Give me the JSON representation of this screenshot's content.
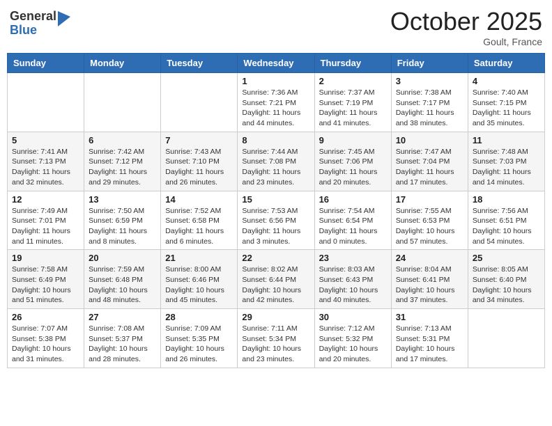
{
  "header": {
    "logo_general": "General",
    "logo_blue": "Blue",
    "month_title": "October 2025",
    "location": "Goult, France"
  },
  "days_of_week": [
    "Sunday",
    "Monday",
    "Tuesday",
    "Wednesday",
    "Thursday",
    "Friday",
    "Saturday"
  ],
  "weeks": [
    [
      {
        "num": "",
        "info": ""
      },
      {
        "num": "",
        "info": ""
      },
      {
        "num": "",
        "info": ""
      },
      {
        "num": "1",
        "info": "Sunrise: 7:36 AM\nSunset: 7:21 PM\nDaylight: 11 hours and 44 minutes."
      },
      {
        "num": "2",
        "info": "Sunrise: 7:37 AM\nSunset: 7:19 PM\nDaylight: 11 hours and 41 minutes."
      },
      {
        "num": "3",
        "info": "Sunrise: 7:38 AM\nSunset: 7:17 PM\nDaylight: 11 hours and 38 minutes."
      },
      {
        "num": "4",
        "info": "Sunrise: 7:40 AM\nSunset: 7:15 PM\nDaylight: 11 hours and 35 minutes."
      }
    ],
    [
      {
        "num": "5",
        "info": "Sunrise: 7:41 AM\nSunset: 7:13 PM\nDaylight: 11 hours and 32 minutes."
      },
      {
        "num": "6",
        "info": "Sunrise: 7:42 AM\nSunset: 7:12 PM\nDaylight: 11 hours and 29 minutes."
      },
      {
        "num": "7",
        "info": "Sunrise: 7:43 AM\nSunset: 7:10 PM\nDaylight: 11 hours and 26 minutes."
      },
      {
        "num": "8",
        "info": "Sunrise: 7:44 AM\nSunset: 7:08 PM\nDaylight: 11 hours and 23 minutes."
      },
      {
        "num": "9",
        "info": "Sunrise: 7:45 AM\nSunset: 7:06 PM\nDaylight: 11 hours and 20 minutes."
      },
      {
        "num": "10",
        "info": "Sunrise: 7:47 AM\nSunset: 7:04 PM\nDaylight: 11 hours and 17 minutes."
      },
      {
        "num": "11",
        "info": "Sunrise: 7:48 AM\nSunset: 7:03 PM\nDaylight: 11 hours and 14 minutes."
      }
    ],
    [
      {
        "num": "12",
        "info": "Sunrise: 7:49 AM\nSunset: 7:01 PM\nDaylight: 11 hours and 11 minutes."
      },
      {
        "num": "13",
        "info": "Sunrise: 7:50 AM\nSunset: 6:59 PM\nDaylight: 11 hours and 8 minutes."
      },
      {
        "num": "14",
        "info": "Sunrise: 7:52 AM\nSunset: 6:58 PM\nDaylight: 11 hours and 6 minutes."
      },
      {
        "num": "15",
        "info": "Sunrise: 7:53 AM\nSunset: 6:56 PM\nDaylight: 11 hours and 3 minutes."
      },
      {
        "num": "16",
        "info": "Sunrise: 7:54 AM\nSunset: 6:54 PM\nDaylight: 11 hours and 0 minutes."
      },
      {
        "num": "17",
        "info": "Sunrise: 7:55 AM\nSunset: 6:53 PM\nDaylight: 10 hours and 57 minutes."
      },
      {
        "num": "18",
        "info": "Sunrise: 7:56 AM\nSunset: 6:51 PM\nDaylight: 10 hours and 54 minutes."
      }
    ],
    [
      {
        "num": "19",
        "info": "Sunrise: 7:58 AM\nSunset: 6:49 PM\nDaylight: 10 hours and 51 minutes."
      },
      {
        "num": "20",
        "info": "Sunrise: 7:59 AM\nSunset: 6:48 PM\nDaylight: 10 hours and 48 minutes."
      },
      {
        "num": "21",
        "info": "Sunrise: 8:00 AM\nSunset: 6:46 PM\nDaylight: 10 hours and 45 minutes."
      },
      {
        "num": "22",
        "info": "Sunrise: 8:02 AM\nSunset: 6:44 PM\nDaylight: 10 hours and 42 minutes."
      },
      {
        "num": "23",
        "info": "Sunrise: 8:03 AM\nSunset: 6:43 PM\nDaylight: 10 hours and 40 minutes."
      },
      {
        "num": "24",
        "info": "Sunrise: 8:04 AM\nSunset: 6:41 PM\nDaylight: 10 hours and 37 minutes."
      },
      {
        "num": "25",
        "info": "Sunrise: 8:05 AM\nSunset: 6:40 PM\nDaylight: 10 hours and 34 minutes."
      }
    ],
    [
      {
        "num": "26",
        "info": "Sunrise: 7:07 AM\nSunset: 5:38 PM\nDaylight: 10 hours and 31 minutes."
      },
      {
        "num": "27",
        "info": "Sunrise: 7:08 AM\nSunset: 5:37 PM\nDaylight: 10 hours and 28 minutes."
      },
      {
        "num": "28",
        "info": "Sunrise: 7:09 AM\nSunset: 5:35 PM\nDaylight: 10 hours and 26 minutes."
      },
      {
        "num": "29",
        "info": "Sunrise: 7:11 AM\nSunset: 5:34 PM\nDaylight: 10 hours and 23 minutes."
      },
      {
        "num": "30",
        "info": "Sunrise: 7:12 AM\nSunset: 5:32 PM\nDaylight: 10 hours and 20 minutes."
      },
      {
        "num": "31",
        "info": "Sunrise: 7:13 AM\nSunset: 5:31 PM\nDaylight: 10 hours and 17 minutes."
      },
      {
        "num": "",
        "info": ""
      }
    ]
  ]
}
